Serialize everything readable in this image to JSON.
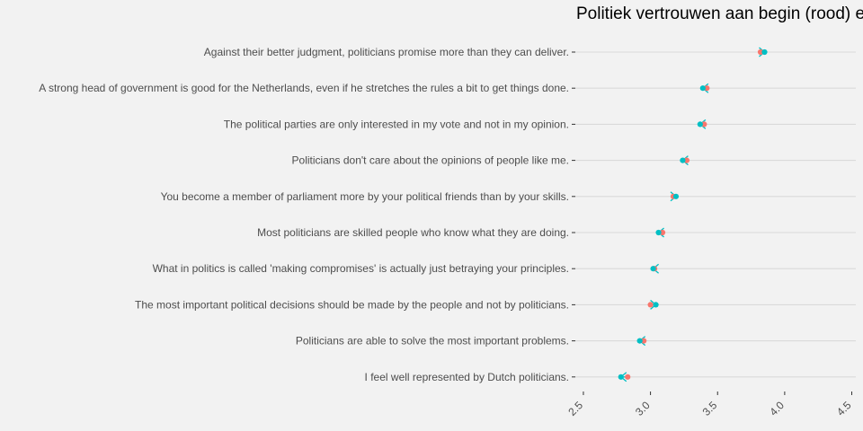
{
  "chart_data": {
    "type": "dot",
    "title": "Politiek vertrouwen aan begin (rood) e",
    "xlabel": "",
    "ylabel": "",
    "xlim": [
      2.44,
      4.53
    ],
    "x_ticks": [
      2.5,
      3.0,
      3.5,
      4.0,
      4.5
    ],
    "x_tick_labels": [
      "2.5",
      "3.0",
      "3.5",
      "4.0",
      "4.5"
    ],
    "grid": true,
    "categories": [
      "Against their better judgment, politicians promise more than they can deliver.",
      "A strong head of government is good for the Netherlands, even if he stretches the rules a bit to get things done.",
      "The political parties are only interested in my vote and not in my opinion.",
      "Politicians don't care about the opinions of people like me.",
      "You become a member of parliament more by your political friends than by your skills.",
      "Most politicians are skilled people who know what they are doing.",
      "What in politics is called 'making compromises' is actually just betraying your principles.",
      "The most important political decisions should be made by the people and not by politicians.",
      "Politicians are able to solve the most important problems.",
      "I feel well represented by Dutch politicians."
    ],
    "series": [
      {
        "color": "#f8766d",
        "values": [
          3.82,
          3.42,
          3.4,
          3.27,
          3.17,
          3.09,
          3.03,
          3.0,
          2.95,
          2.83
        ]
      },
      {
        "color": "#00bfc4",
        "values": [
          3.85,
          3.39,
          3.37,
          3.24,
          3.19,
          3.06,
          3.02,
          3.04,
          2.92,
          2.78
        ]
      }
    ]
  }
}
